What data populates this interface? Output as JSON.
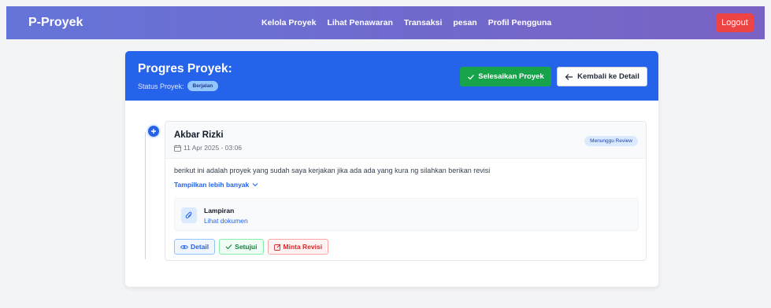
{
  "navbar": {
    "brand": "P-Proyek",
    "links": [
      "Kelola Proyek",
      "Lihat Penawaran",
      "Transaksi",
      "pesan",
      "Profil Pengguna"
    ],
    "logout_label": "Logout"
  },
  "header": {
    "title": "Progres Proyek:",
    "status_label": "Status Proyek:",
    "status_value": "Berjalan",
    "finish_label": "Selesaikan Proyek",
    "back_label": "Kembali ke Detail"
  },
  "entry": {
    "author": "Akbar Rizki",
    "datetime": "11 Apr 2025 - 03:06",
    "badge": "Menunggu Review",
    "message": "berikut ini adalah proyek yang sudah saya kerjakan jika ada ada yang kura ng silahkan berikan revisi",
    "show_more": "Tampilkan lebih banyak",
    "attachment": {
      "title": "Lampiran",
      "link": "Lihat dokumen"
    },
    "actions": {
      "detail": "Detail",
      "approve": "Setujui",
      "revise": "Minta Revisi"
    }
  },
  "colors": {
    "primary": "#2563eb",
    "success": "#16a34a",
    "danger": "#ef4444"
  },
  "icons": [
    "check-icon",
    "arrow-left-icon",
    "plus-icon",
    "calendar-icon",
    "chevron-down-icon",
    "paperclip-icon",
    "eye-icon",
    "edit-icon"
  ]
}
